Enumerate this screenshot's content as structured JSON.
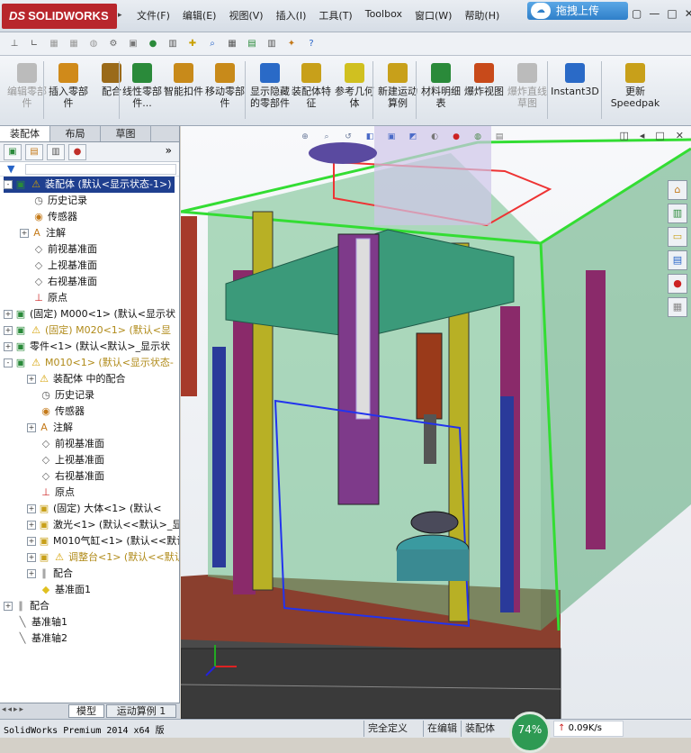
{
  "titlebar": {
    "brand_prefix": "DS",
    "brand": "SOLIDWORKS",
    "menus": [
      "文件(F)",
      "编辑(E)",
      "视图(V)",
      "插入(I)",
      "工具(T)",
      "Toolbox",
      "窗口(W)",
      "帮助(H)"
    ],
    "upload_label": "拖拽上传"
  },
  "qat": {
    "icons": [
      "pin-icon",
      "ruler-icon",
      "save-icon",
      "print-icon",
      "rebuild-icon",
      "gear-icon",
      "cube-icon",
      "map-pin-icon",
      "bars-icon",
      "move-icon",
      "zoom-icon",
      "grid-icon",
      "excel-icon",
      "printer-icon",
      "sparkle-icon",
      "help-icon"
    ]
  },
  "ribbon": {
    "buttons": [
      {
        "label": "编辑零部件",
        "enabled": false
      },
      {
        "label": "插入零部件",
        "enabled": true
      },
      {
        "label": "配合",
        "enabled": true
      },
      {
        "label": "线性零部件...",
        "enabled": true
      },
      {
        "label": "智能扣件",
        "enabled": true
      },
      {
        "label": "移动零部件",
        "enabled": true
      },
      {
        "label": "显示隐藏的零部件",
        "enabled": true
      },
      {
        "label": "装配体特征",
        "enabled": true
      },
      {
        "label": "参考几何体",
        "enabled": true
      },
      {
        "label": "新建运动算例",
        "enabled": true
      },
      {
        "label": "材料明细表",
        "enabled": true
      },
      {
        "label": "爆炸视图",
        "enabled": true
      },
      {
        "label": "爆炸直线草图",
        "enabled": false
      },
      {
        "label": "Instant3D",
        "enabled": true
      },
      {
        "label": "更新Speedpak",
        "enabled": true
      }
    ]
  },
  "panel": {
    "tabs": [
      "装配体",
      "布局",
      "草图"
    ],
    "active_tab": "装配体",
    "more": "»",
    "tree": [
      {
        "text": "装配体  (默认<显示状态-1>)",
        "icon": "assembly",
        "warn": true,
        "selected": true,
        "level": 0,
        "expand": "-"
      },
      {
        "text": "历史记录",
        "icon": "history",
        "level": 1
      },
      {
        "text": "传感器",
        "icon": "sensor",
        "level": 1
      },
      {
        "text": "注解",
        "icon": "annotation",
        "level": 1,
        "expand": "+"
      },
      {
        "text": "前视基准面",
        "icon": "plane",
        "level": 1
      },
      {
        "text": "上视基准面",
        "icon": "plane",
        "level": 1
      },
      {
        "text": "右视基准面",
        "icon": "plane",
        "level": 1
      },
      {
        "text": "原点",
        "icon": "origin",
        "level": 1
      },
      {
        "text": "(固定) M000<1> (默认<显示状",
        "icon": "assembly",
        "level": 0,
        "expand": "+"
      },
      {
        "text": "(固定) M020<1> (默认<显",
        "icon": "assembly",
        "warn": true,
        "yellow": true,
        "level": 0,
        "expand": "+"
      },
      {
        "text": "零件<1> (默认<默认>_显示状",
        "icon": "assembly",
        "level": 0,
        "expand": "+"
      },
      {
        "text": "M010<1> (默认<显示状态-",
        "icon": "assembly",
        "warn": true,
        "yellow": true,
        "level": 0,
        "expand": "-"
      },
      {
        "text": "装配体 中的配合",
        "icon": "warn",
        "level": 2,
        "expand": "+"
      },
      {
        "text": "历史记录",
        "icon": "history",
        "level": 2
      },
      {
        "text": "传感器",
        "icon": "sensor",
        "level": 2
      },
      {
        "text": "注解",
        "icon": "annotation",
        "level": 2,
        "expand": "+"
      },
      {
        "text": "前视基准面",
        "icon": "plane",
        "level": 2
      },
      {
        "text": "上视基准面",
        "icon": "plane",
        "level": 2
      },
      {
        "text": "右视基准面",
        "icon": "plane",
        "level": 2
      },
      {
        "text": "原点",
        "icon": "origin",
        "level": 2
      },
      {
        "text": "(固定) 大体<1> (默认<",
        "icon": "part",
        "level": 2,
        "expand": "+"
      },
      {
        "text": "激光<1> (默认<<默认>_显",
        "icon": "part",
        "level": 2,
        "expand": "+"
      },
      {
        "text": "M010气缸<1> (默认<<默认",
        "icon": "part",
        "level": 2,
        "expand": "+"
      },
      {
        "text": "调整台<1> (默认<<默认",
        "icon": "part",
        "warn": true,
        "yellow": true,
        "level": 2,
        "expand": "+"
      },
      {
        "text": "配合",
        "icon": "mate",
        "level": 2,
        "expand": "+"
      },
      {
        "text": "基准面1",
        "icon": "plane-yellow",
        "level": 2
      },
      {
        "text": "配合",
        "icon": "mate",
        "level": 0,
        "expand": "+"
      },
      {
        "text": "基准轴1",
        "icon": "axis",
        "level": 0
      },
      {
        "text": "基准轴2",
        "icon": "axis",
        "level": 0
      }
    ],
    "bottom_tabs": [
      "模型",
      "运动算例 1"
    ]
  },
  "viewport": {
    "hud_icons": [
      "zoom-fit-icon",
      "zoom-area-icon",
      "previous-view-icon",
      "section-view-icon",
      "view-orientation-icon",
      "display-style-icon",
      "hide-show-icon",
      "appearance-icon",
      "scene-icon",
      "view-settings-icon"
    ],
    "window_buttons": [
      "◫",
      "◂",
      "□",
      "✕"
    ]
  },
  "taskpane": [
    "home-icon",
    "library-icon",
    "folder-icon",
    "properties-icon",
    "appearance-icon",
    "custom-icon"
  ],
  "status": {
    "app": "SolidWorks Premium 2014 x64 版",
    "define": "完全定义",
    "editing": "在编辑",
    "assembly": "装配体",
    "speed_pct": "74%",
    "net": "0.09K/s"
  }
}
